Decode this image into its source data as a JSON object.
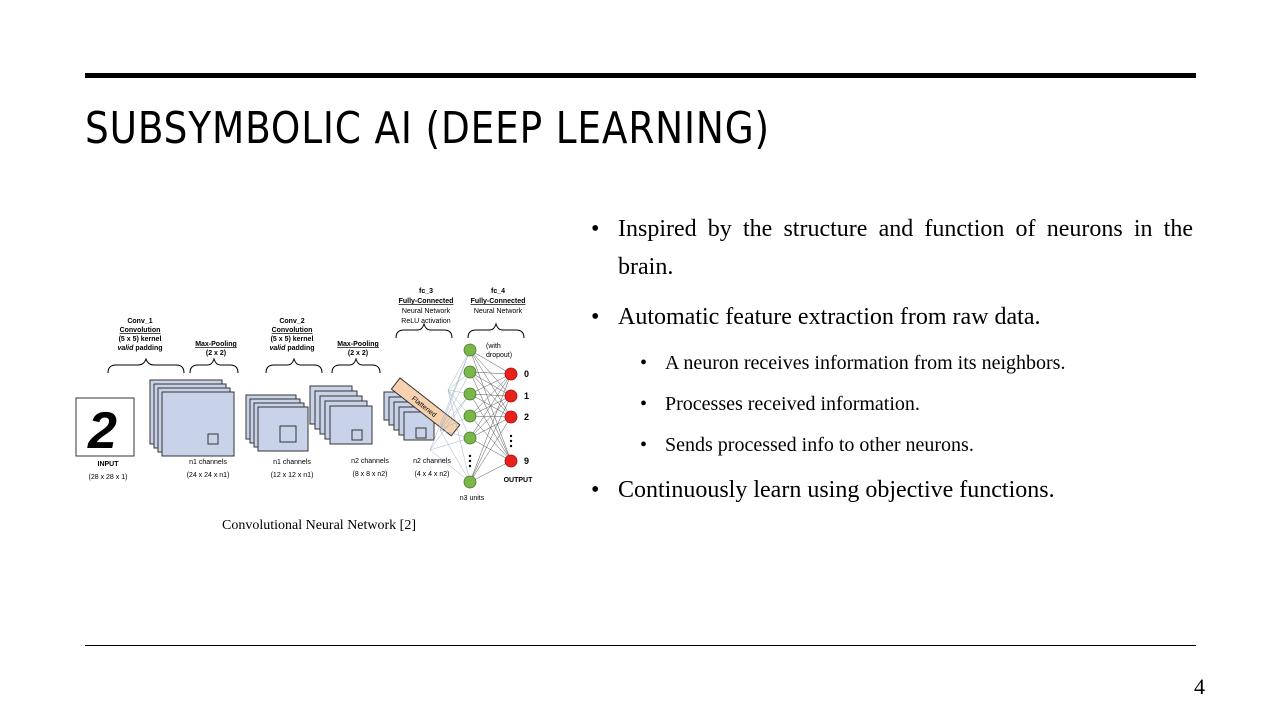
{
  "slide": {
    "title": "SUBSYMBOLIC AI (DEEP LEARNING)",
    "page_number": "4"
  },
  "figure": {
    "caption": "Convolutional Neural Network [2]",
    "labels": {
      "conv1_name": "Conv_1",
      "conv1_type": "Convolution",
      "conv1_kernel": "(5 x 5) kernel",
      "conv1_pad_em": "valid",
      "conv1_pad": " padding",
      "pool1_name": "Max-Pooling",
      "pool1_size": "(2 x 2)",
      "conv2_name": "Conv_2",
      "conv2_type": "Convolution",
      "conv2_kernel": "(5 x 5) kernel",
      "conv2_pad_em": "valid",
      "conv2_pad": " padding",
      "pool2_name": "Max-Pooling",
      "pool2_size": "(2 x 2)",
      "fc3_name": "fc_3",
      "fc3_type": "Fully-Connected",
      "fc3_desc": "Neural Network",
      "fc3_act": "ReLU activation",
      "fc4_name": "fc_4",
      "fc4_type": "Fully-Connected",
      "fc4_desc": "Neural Network",
      "dropout_1": "(with",
      "dropout_2": "dropout)",
      "flattened": "Flattened",
      "input": "INPUT",
      "input_dim": "(28 x 28 x 1)",
      "ch1": "n1 channels",
      "ch1_dim": "(24 x 24 x n1)",
      "ch2": "n1 channels",
      "ch2_dim": "(12 x 12 x n1)",
      "ch3": "n2 channels",
      "ch3_dim": "(8 x 8 x n2)",
      "ch4": "n2 channels",
      "ch4_dim": "(4 x 4 x n2)",
      "n3": "n3 units",
      "output": "OUTPUT",
      "out_0": "0",
      "out_1": "1",
      "out_2": "2",
      "out_9": "9",
      "digit": "2"
    }
  },
  "bullets": [
    {
      "text": "Inspired by the structure and function of neurons in the brain."
    },
    {
      "text": "Automatic feature extraction from raw data."
    }
  ],
  "sub_bullets": [
    {
      "text": "A neuron receives information from its neighbors."
    },
    {
      "text": "Processes received information."
    },
    {
      "text": "Sends processed info to other neurons."
    }
  ],
  "last_bullet": {
    "text": "Continuously learn using objective functions."
  },
  "bullet_glyph": "•"
}
